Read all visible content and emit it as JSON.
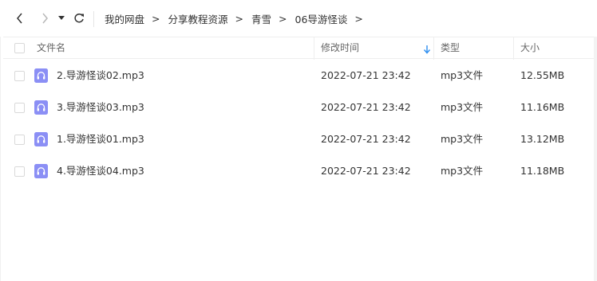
{
  "toolbar": {
    "back_icon": "chevron-left-icon",
    "forward_icon": "chevron-right-icon",
    "dropdown_icon": "caret-down-icon",
    "refresh_icon": "refresh-icon"
  },
  "breadcrumb": {
    "items": [
      "我的网盘",
      "分享教程资源",
      "青雪",
      "06导游怪谈"
    ],
    "separator": ">"
  },
  "table": {
    "columns": {
      "name": "文件名",
      "modified": "修改时间",
      "type": "类型",
      "size": "大小"
    },
    "sort_indicator": "sort-down-arrow-icon",
    "rows": [
      {
        "name": "2.导游怪谈02.mp3",
        "modified": "2022-07-21 23:42",
        "type": "mp3文件",
        "size": "12.55MB",
        "icon": "audio-file-icon"
      },
      {
        "name": "3.导游怪谈03.mp3",
        "modified": "2022-07-21 23:42",
        "type": "mp3文件",
        "size": "11.16MB",
        "icon": "audio-file-icon"
      },
      {
        "name": "1.导游怪谈01.mp3",
        "modified": "2022-07-21 23:42",
        "type": "mp3文件",
        "size": "13.12MB",
        "icon": "audio-file-icon"
      },
      {
        "name": "4.导游怪谈04.mp3",
        "modified": "2022-07-21 23:42",
        "type": "mp3文件",
        "size": "11.18MB",
        "icon": "audio-file-icon"
      }
    ]
  },
  "colors": {
    "accent": "#2e8ff0",
    "audio_icon": "#8b8ff5",
    "border": "#eeeeee"
  }
}
